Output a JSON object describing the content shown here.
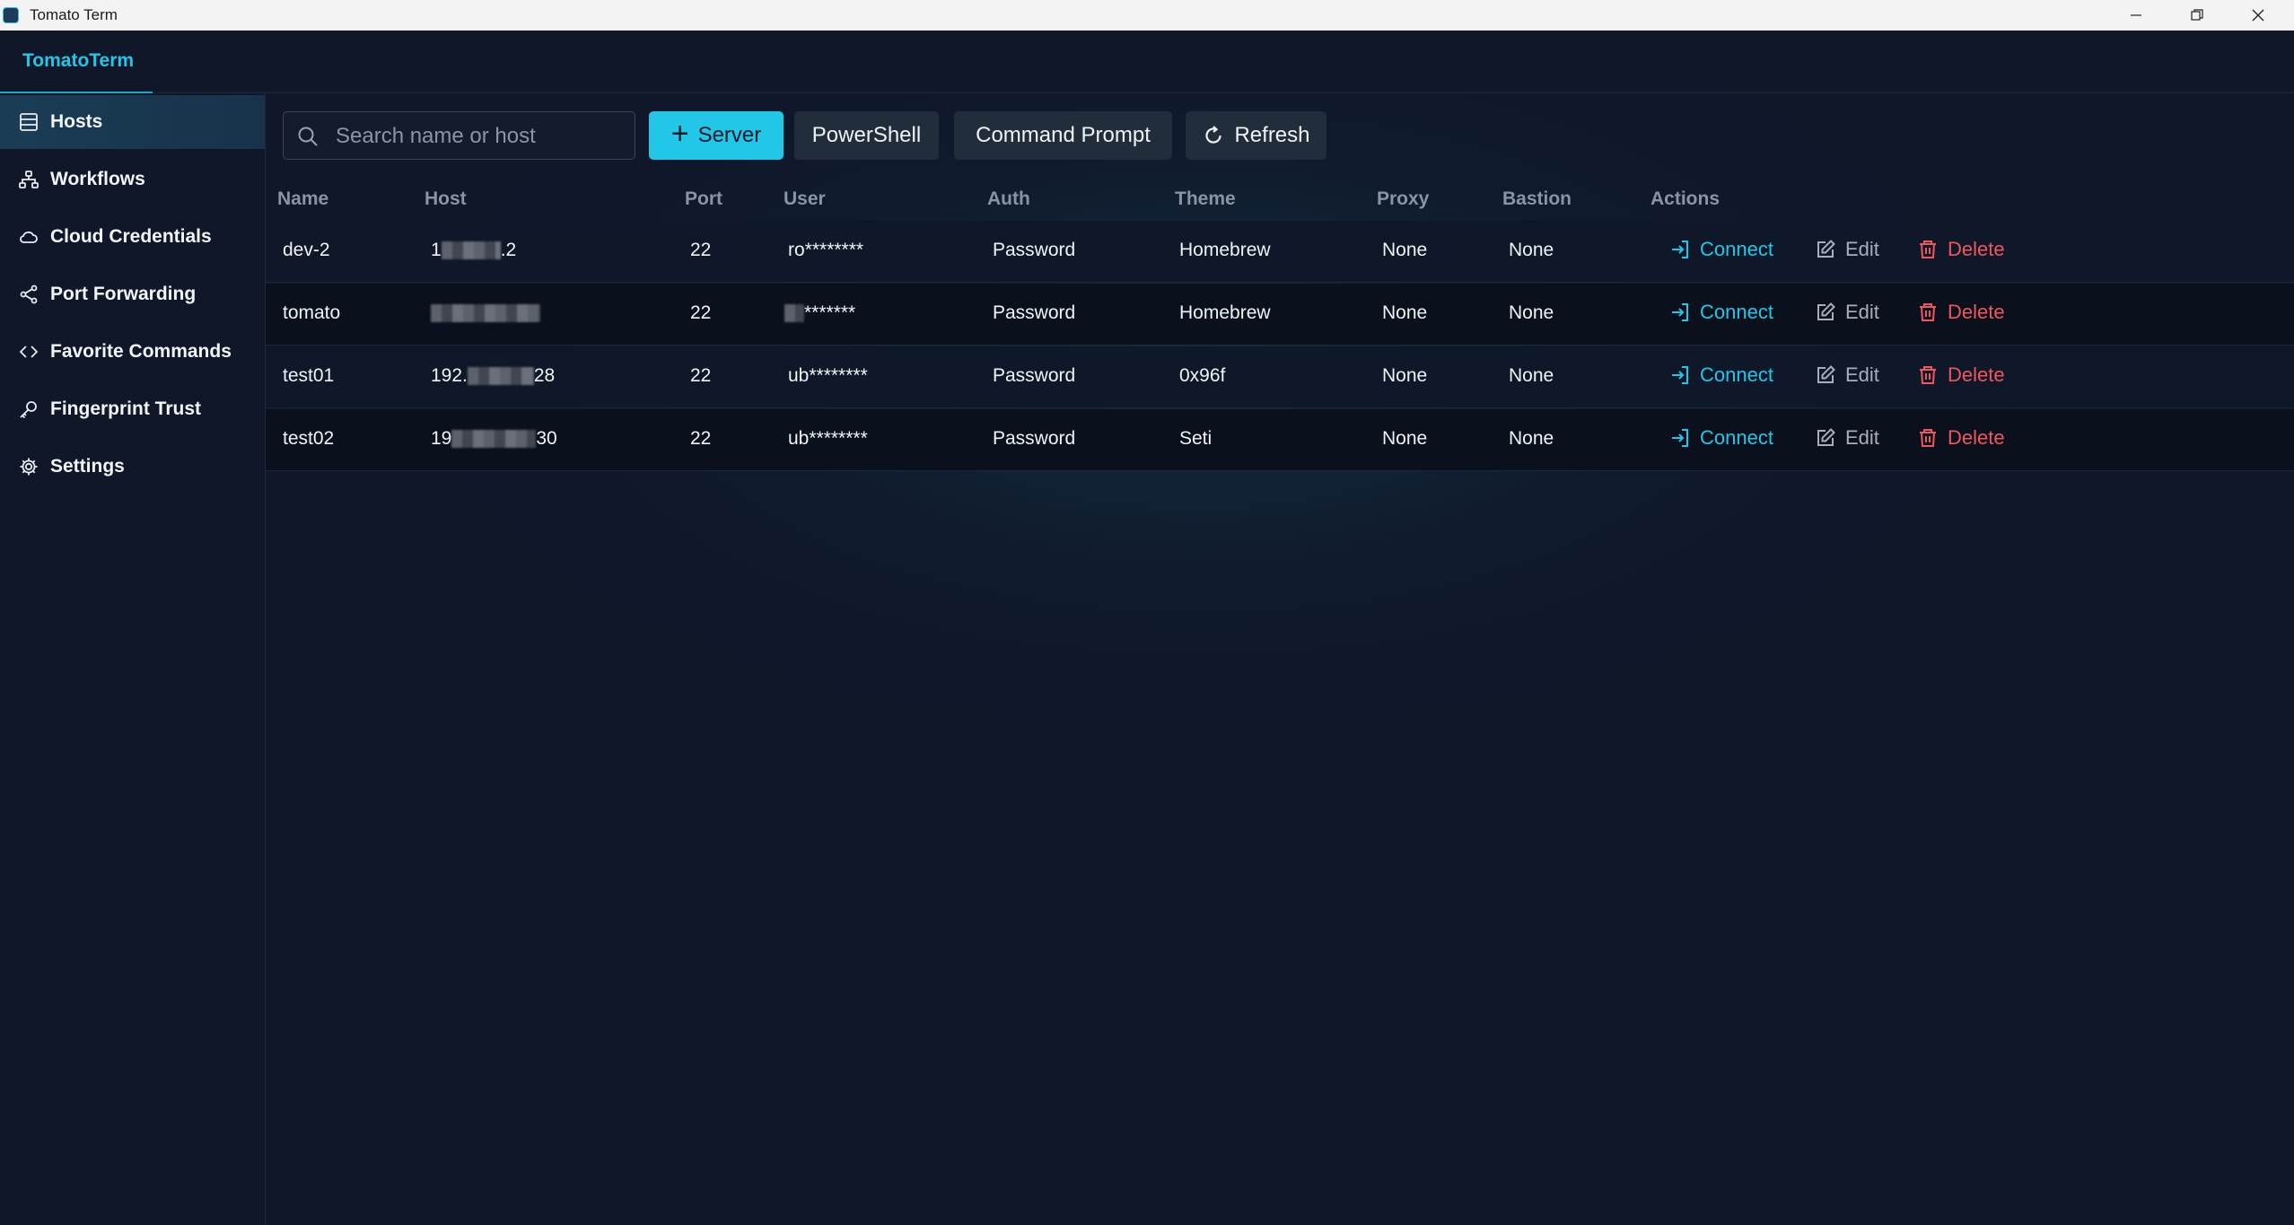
{
  "window": {
    "title": "Tomato Term",
    "minimize": "—",
    "maximize": "❐",
    "close": "✕"
  },
  "header": {
    "brand": "TomatoTerm"
  },
  "sidebar": {
    "items": [
      {
        "label": "Hosts",
        "icon": "server-list-icon",
        "active": true
      },
      {
        "label": "Workflows",
        "icon": "workflow-icon",
        "active": false
      },
      {
        "label": "Cloud Credentials",
        "icon": "cloud-icon",
        "active": false
      },
      {
        "label": "Port Forwarding",
        "icon": "share-icon",
        "active": false
      },
      {
        "label": "Favorite Commands",
        "icon": "code-icon",
        "active": false
      },
      {
        "label": "Fingerprint Trust",
        "icon": "key-icon",
        "active": false
      },
      {
        "label": "Settings",
        "icon": "gear-icon",
        "active": false
      }
    ]
  },
  "toolbar": {
    "search_placeholder": "Search name or host",
    "server_label": "Server",
    "powershell_label": "PowerShell",
    "command_prompt_label": "Command Prompt",
    "refresh_label": "Refresh"
  },
  "table": {
    "columns": [
      "Name",
      "Host",
      "Port",
      "User",
      "Auth",
      "Theme",
      "Proxy",
      "Bastion",
      "Actions"
    ],
    "actions": {
      "connect": "Connect",
      "edit": "Edit",
      "delete": "Delete"
    },
    "rows": [
      {
        "name": "dev-2",
        "host_prefix": "1",
        "host_suffix": ".2",
        "port": "22",
        "user_prefix": "ro",
        "user_suffix": "********",
        "auth": "Password",
        "theme": "Homebrew",
        "proxy": "None",
        "bastion": "None"
      },
      {
        "name": "tomato",
        "host_prefix": "",
        "host_suffix": "",
        "port": "22",
        "user_prefix": "",
        "user_suffix": "*******",
        "auth": "Password",
        "theme": "Homebrew",
        "proxy": "None",
        "bastion": "None"
      },
      {
        "name": "test01",
        "host_prefix": "192.",
        "host_suffix": "28",
        "port": "22",
        "user_prefix": "ub",
        "user_suffix": "********",
        "auth": "Password",
        "theme": "0x96f",
        "proxy": "None",
        "bastion": "None"
      },
      {
        "name": "test02",
        "host_prefix": "19",
        "host_suffix": "30",
        "port": "22",
        "user_prefix": "ub",
        "user_suffix": "********",
        "auth": "Password",
        "theme": "Seti",
        "proxy": "None",
        "bastion": "None"
      }
    ]
  },
  "colors": {
    "accent": "#22c7e8",
    "danger": "#f0565e",
    "background": "#0f1729"
  }
}
